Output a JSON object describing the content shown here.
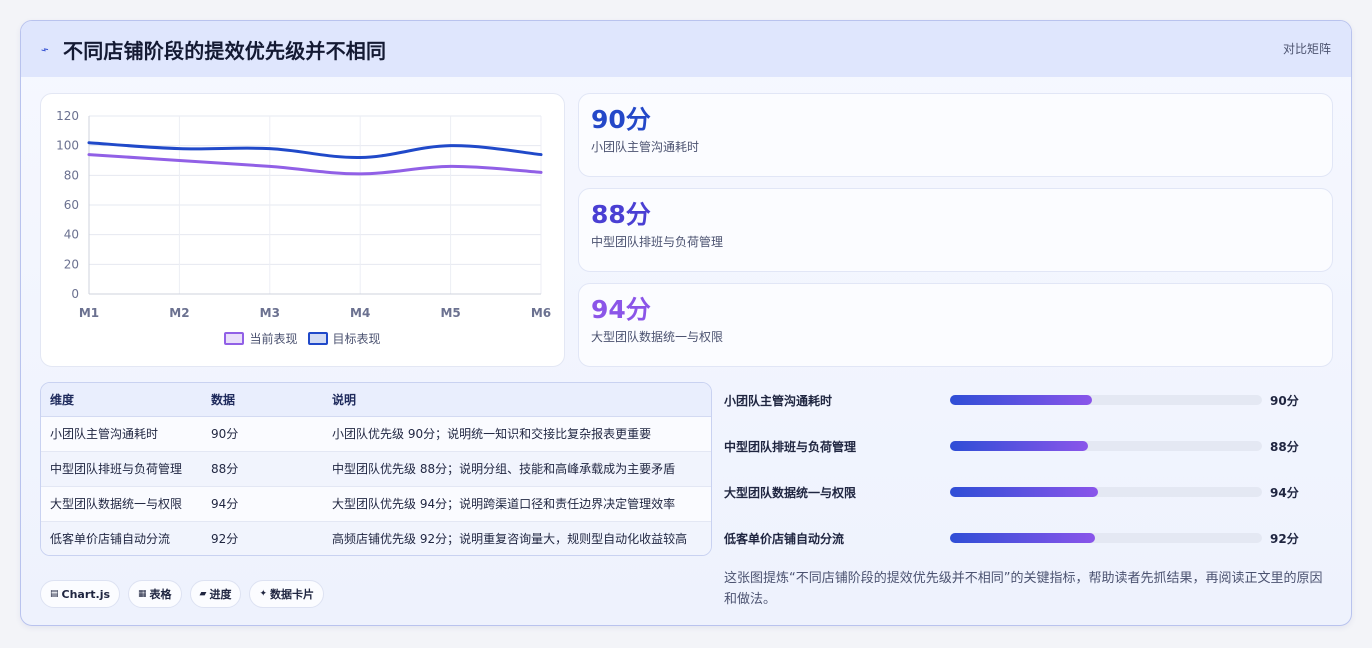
{
  "header": {
    "title": "不同店铺阶段的提效优先级并不相同",
    "tag": "对比矩阵",
    "spark_icon": "⌁"
  },
  "chart_data": {
    "type": "line",
    "x": [
      "M1",
      "M2",
      "M3",
      "M4",
      "M5",
      "M6"
    ],
    "yticks": [
      "0",
      "20",
      "40",
      "60",
      "80",
      "100",
      "120"
    ],
    "ylim": [
      0,
      120
    ],
    "series": [
      {
        "name": "当前表现",
        "values": [
          94,
          90,
          86,
          81,
          86,
          82
        ],
        "color": "#9160e6"
      },
      {
        "name": "目标表现",
        "values": [
          102,
          98,
          98,
          92,
          100,
          94
        ],
        "color": "#2049c9"
      }
    ]
  },
  "kpis": [
    {
      "value": "90分",
      "label": "小团队主管沟通耗时",
      "color": "#2448c8"
    },
    {
      "value": "88分",
      "label": "中型团队排班与负荷管理",
      "color": "#4a3fd3"
    },
    {
      "value": "94分",
      "label": "大型团队数据统一与权限",
      "color": "#8b55e8"
    }
  ],
  "table": {
    "headers": [
      "维度",
      "数据",
      "说明"
    ],
    "rows": [
      [
        "小团队主管沟通耗时",
        "90分",
        "小团队优先级 90分；说明统一知识和交接比复杂报表更重要"
      ],
      [
        "中型团队排班与负荷管理",
        "88分",
        "中型团队优先级 88分；说明分组、技能和高峰承载成为主要矛盾"
      ],
      [
        "大型团队数据统一与权限",
        "94分",
        "大型团队优先级 94分；说明跨渠道口径和责任边界决定管理效率"
      ],
      [
        "低客单价店铺自动分流",
        "92分",
        "高频店铺优先级 92分；说明重复咨询量大，规则型自动化收益较高"
      ]
    ]
  },
  "chips": [
    {
      "icon": "▤",
      "label": "Chart.js"
    },
    {
      "icon": "▦",
      "label": "表格"
    },
    {
      "icon": "▰",
      "label": "进度"
    },
    {
      "icon": "✦",
      "label": "数据卡片"
    }
  ],
  "progress": [
    {
      "label": "小团队主管沟通耗时",
      "value": "90分",
      "fraction": 0.455
    },
    {
      "label": "中型团队排班与负荷管理",
      "value": "88分",
      "fraction": 0.443
    },
    {
      "label": "大型团队数据统一与权限",
      "value": "94分",
      "fraction": 0.475
    },
    {
      "label": "低客单价店铺自动分流",
      "value": "92分",
      "fraction": 0.465
    }
  ],
  "note": "这张图提炼“不同店铺阶段的提效优先级并不相同”的关键指标，帮助读者先抓结果，再阅读正文里的原因和做法。"
}
